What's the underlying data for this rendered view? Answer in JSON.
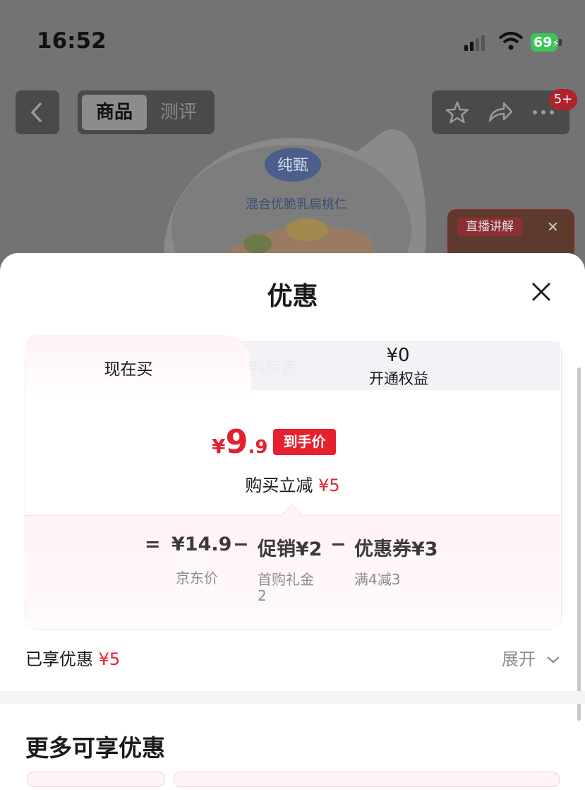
{
  "status_bar": {
    "time": "16:52",
    "battery": "69"
  },
  "nav": {
    "tab_goods": "商品",
    "tab_review": "测评",
    "badge": "5+"
  },
  "live": {
    "label": "直播讲解"
  },
  "product": {
    "brand": "纯甄",
    "desc": "混合优脆乳扁桃仁"
  },
  "sheet": {
    "title": "优惠",
    "tab_now": "现在买",
    "tab_ghost": "鸭屎香",
    "tab_price": "¥0",
    "tab_benefit": "开通权益",
    "price": {
      "yen": "¥",
      "int": "9",
      "dec": ".9"
    },
    "price_tag": "到手价",
    "discount_label": "购买立减",
    "discount_value": "¥5",
    "formula": {
      "equals": "=",
      "jd_price": "¥14.9",
      "minus1": "−",
      "promo": "促销¥2",
      "minus2": "−",
      "coupon": "优惠券¥3",
      "jd_label": "京东价",
      "promo_sub_1": "首购礼金",
      "promo_sub_2": "2",
      "coupon_sub": "满4减3"
    },
    "enjoyed_label": "已享优惠",
    "enjoyed_value": "¥5",
    "expand_label": "展开",
    "more_title": "更多可享优惠"
  }
}
